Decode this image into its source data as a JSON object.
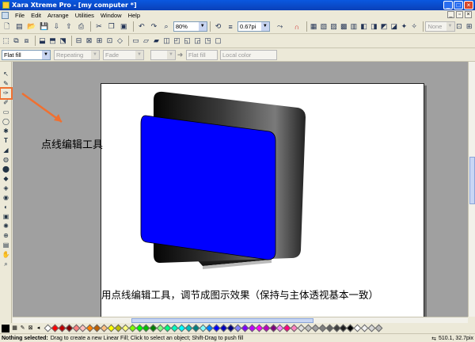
{
  "window": {
    "title": "Xara Xtreme Pro - [my computer *]",
    "min": "_",
    "max": "□",
    "close": "×"
  },
  "menu": {
    "items": [
      "File",
      "Edit",
      "Arrange",
      "Utilities",
      "Window",
      "Help"
    ]
  },
  "toolbar1": {
    "zoom": "80%",
    "line_width": "0.67pi",
    "style": "None"
  },
  "toolbar3": {
    "fill_type": "Flat fill",
    "repeat": "Repeating",
    "fade": "Fade",
    "fill_name": "Flat fill",
    "color": "Local color"
  },
  "annotation": {
    "tool_label": "点线编辑工具"
  },
  "caption": "用点线编辑工具，调节成图示效果（保持与主体透视基本一致）",
  "status": {
    "selection": "Nothing selected:",
    "hint": "Drag to create a new Linear Fill; Click to select an object; Shift-Drag to push fill",
    "coords": "510.1, 32.7pix"
  },
  "palette": {
    "colors": [
      "#ffffff",
      "#ff0000",
      "#c00000",
      "#800000",
      "#ff8080",
      "#ffc0c0",
      "#ff8000",
      "#c06000",
      "#ffc080",
      "#ffff00",
      "#c0c000",
      "#ffff80",
      "#80ff00",
      "#00ff00",
      "#00c000",
      "#008000",
      "#80ff80",
      "#00ff80",
      "#00ffc0",
      "#00ffff",
      "#00c0c0",
      "#008080",
      "#80ffff",
      "#0080ff",
      "#0000ff",
      "#0000c0",
      "#000080",
      "#8080ff",
      "#8000ff",
      "#c000ff",
      "#ff00ff",
      "#c000c0",
      "#800080",
      "#ff80ff",
      "#ff0080",
      "#ff80c0",
      "#e0e0e0",
      "#c0c0c0",
      "#a0a0a0",
      "#808080",
      "#606060",
      "#404040",
      "#202020",
      "#000000",
      "#ffffff",
      "#f0f0f0",
      "#d8d8d8",
      "#b8b8b8"
    ]
  },
  "accent": {
    "annotation": "#f07030",
    "screen_blue": "#0000ff"
  }
}
